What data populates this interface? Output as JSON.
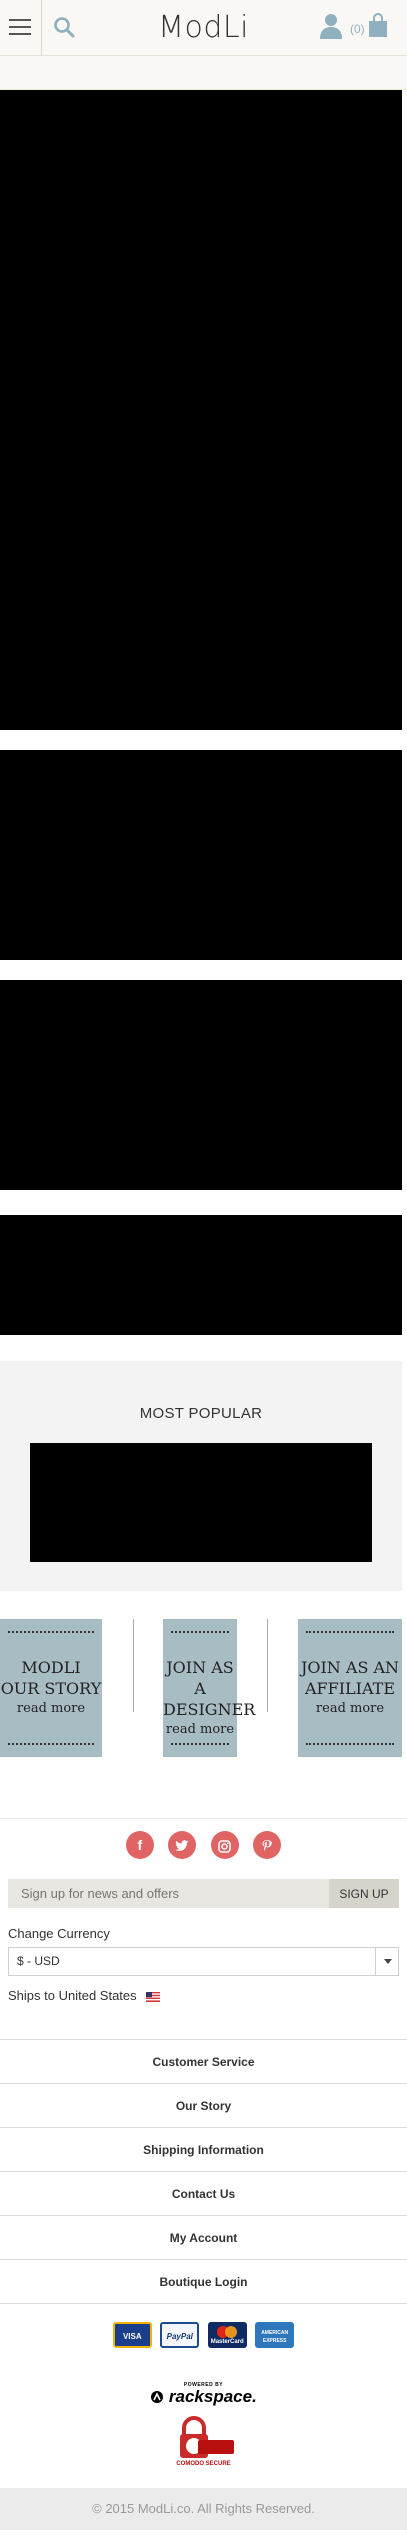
{
  "header": {
    "logo_text": "ModLi",
    "cart_count": "(0)",
    "icons": [
      "hamburger-menu-icon",
      "search-icon",
      "user-icon",
      "shopping-bag-icon"
    ]
  },
  "sections": {
    "popular_title": "MOST POPULAR"
  },
  "cards": [
    {
      "title": "MODLI OUR STORY",
      "more": "read more"
    },
    {
      "title": "JOIN AS A DESIGNER",
      "more": "read more"
    },
    {
      "title": "JOIN AS AN AFFILIATE",
      "more": "read more"
    }
  ],
  "footer": {
    "social_icons": [
      "facebook-icon",
      "twitter-icon",
      "instagram-icon",
      "pinterest-icon"
    ],
    "signup_placeholder": "Sign up for news and offers",
    "signup_button": "SIGN UP",
    "currency_label": "Change Currency",
    "currency_value": "$ - USD",
    "ships_label": "Ships to",
    "ships_country": "United States",
    "links": [
      "Customer Service",
      "Our Story",
      "Shipping Information",
      "Contact Us",
      "My Account",
      "Boutique Login"
    ],
    "payments": [
      "VISA",
      "PayPal",
      "MasterCard",
      "AMERICAN EXPRESS"
    ],
    "powered_by": "POWERED BY",
    "rackspace": "rackspace.",
    "comodo": "COMODO SECURE",
    "copyright": "© 2015 ModLi.co. All Rights Reserved."
  },
  "colors": {
    "accent_blue": "#8fb0be",
    "card_blue": "#a8bcc4",
    "social_red": "#e06464",
    "header_bg": "#faf8f4"
  }
}
